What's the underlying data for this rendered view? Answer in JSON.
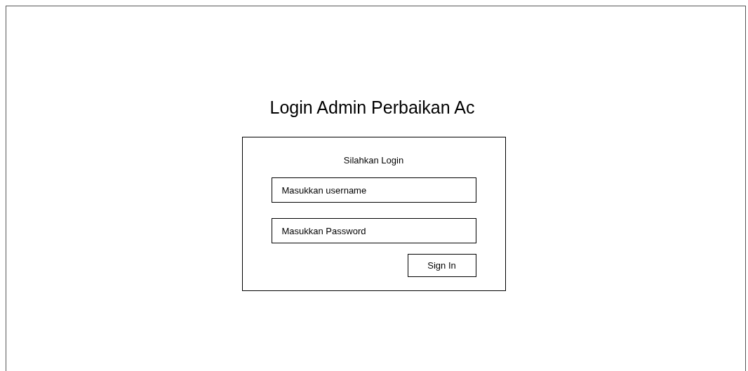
{
  "title": "Login Admin Perbaikan Ac",
  "login_box": {
    "heading": "Silahkan Login",
    "username": {
      "placeholder": "Masukkan username"
    },
    "password": {
      "placeholder": "Masukkan Password"
    },
    "sign_in_button": "Sign In"
  }
}
